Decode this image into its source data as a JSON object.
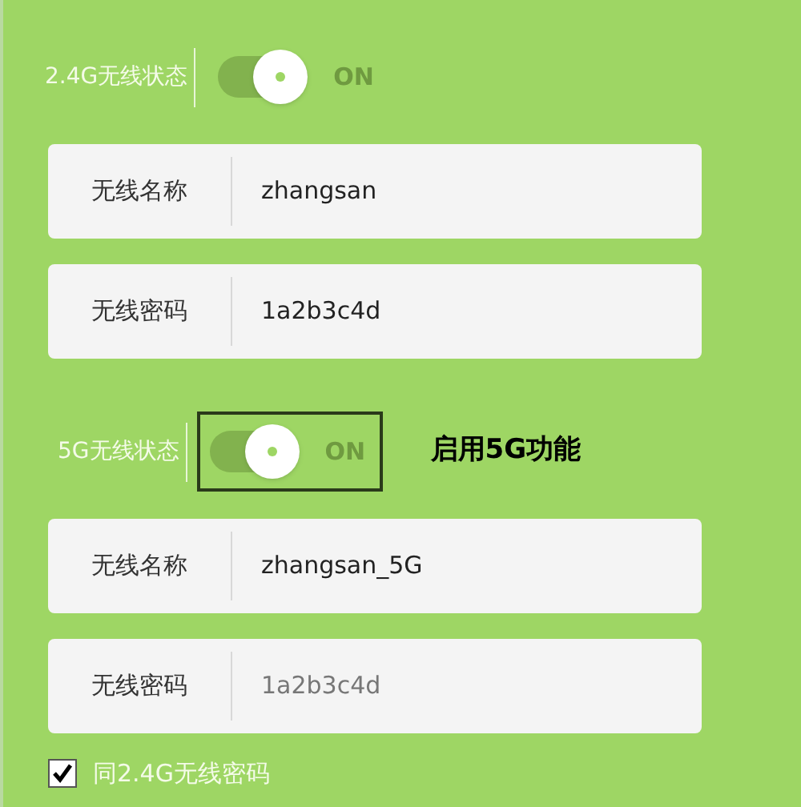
{
  "sections": [
    {
      "status_label": "2.4G无线状态",
      "toggle": {
        "on": true,
        "label": "ON",
        "highlighted": false
      },
      "fields": [
        {
          "label": "无线名称",
          "value": "zhangsan",
          "disabled": false
        },
        {
          "label": "无线密码",
          "value": "1a2b3c4d",
          "disabled": false
        }
      ]
    },
    {
      "status_label": "5G无线状态",
      "toggle": {
        "on": true,
        "label": "ON",
        "highlighted": true
      },
      "annotation": "启用5G功能",
      "fields": [
        {
          "label": "无线名称",
          "value": "zhangsan_5G",
          "disabled": false
        },
        {
          "label": "无线密码",
          "value": "1a2b3c4d",
          "disabled": true
        }
      ]
    }
  ],
  "same_password": {
    "label": "同2.4G无线密码",
    "checked": true
  }
}
